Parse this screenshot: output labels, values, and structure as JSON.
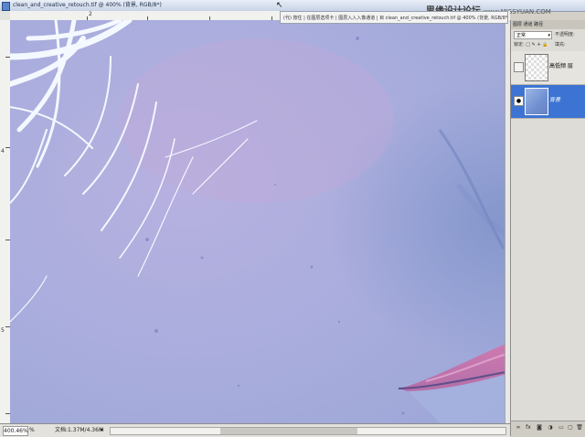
{
  "window": {
    "title": "clean_and_creative_retouch.tif @ 400% (背景, RGB/8*)"
  },
  "tooltip": {
    "text": "(代) 按住 | 在图层选项卡 | 图层入入入像通道 | 目 clean_and_creative_retouch.tif @ 400% (背景, RGB/8*)"
  },
  "watermark": {
    "text": "思缘设计论坛",
    "url": "www.MISSYUAN.COM"
  },
  "ruler": {
    "top_numbers": [
      "2"
    ],
    "left_numbers": [
      "4",
      "5"
    ]
  },
  "status": {
    "zoom": "400.46%",
    "percent_icon": "%",
    "doc_size": "文档:1.37M/4.36M",
    "arrow": "▸"
  },
  "layers_panel": {
    "tabs": "图层 通道 路径",
    "blend_mode": "正常",
    "opacity_label": "不透明度:",
    "lock_label": "锁定: □ ✎ ✛ 🔒",
    "fill_label": "填充:",
    "layers": [
      {
        "name": "高低频 层",
        "visible": false
      },
      {
        "name": "背景",
        "visible": true,
        "selected": true
      }
    ],
    "bottom_icons": [
      "link-icon",
      "fx-icon",
      "mask-icon",
      "adjustment-icon",
      "group-icon",
      "new-layer-icon",
      "trash-icon"
    ]
  },
  "colors": {
    "skin_base": "#a7a8d9",
    "lip": "#c97aa8",
    "hair": "#f4f8ff",
    "selected_layer": "#3d74d4"
  }
}
